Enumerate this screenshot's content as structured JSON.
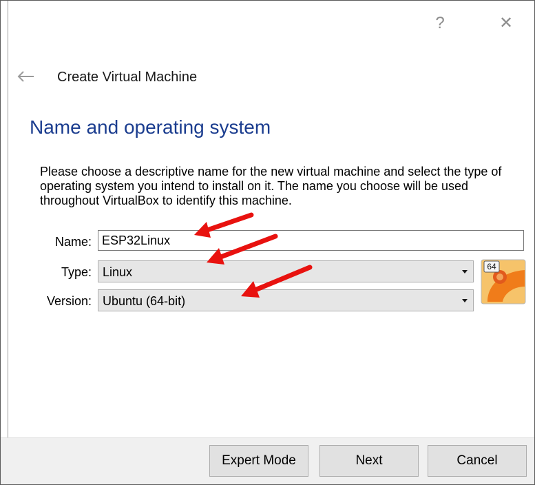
{
  "window": {
    "help_glyph": "?",
    "close_glyph": "✕"
  },
  "wizard": {
    "title": "Create Virtual Machine",
    "back_icon": "back-arrow-icon"
  },
  "page": {
    "title": "Name and operating system",
    "description": "Please choose a descriptive name for the new virtual machine and select the type of operating system you intend to install on it. The name you choose will be used throughout VirtualBox to identify this machine."
  },
  "form": {
    "name_label": "Name:",
    "name_value": "ESP32Linux",
    "type_label": "Type:",
    "type_value": "Linux",
    "version_label": "Version:",
    "version_value": "Ubuntu (64-bit)",
    "os_icon_badge": "64"
  },
  "buttons": {
    "expert_mode": "Expert Mode",
    "next": "Next",
    "cancel": "Cancel"
  },
  "annotations": {
    "arrow_color": "#e8120f"
  },
  "colors": {
    "page_title": "#1b3d8f",
    "footer_bg": "#f0f0f0"
  }
}
